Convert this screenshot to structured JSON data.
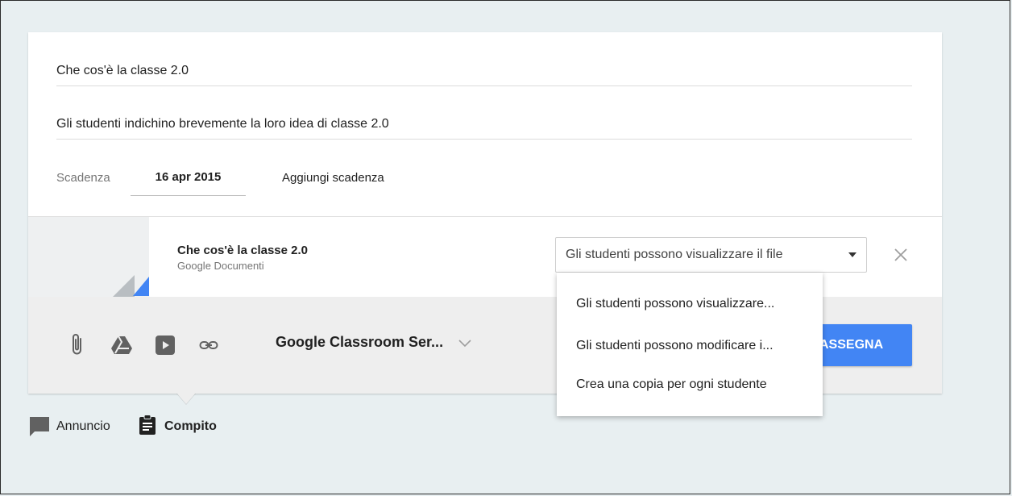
{
  "assignment": {
    "title": "Che cos'è la classe 2.0",
    "description": "Gli studenti indichino brevemente la loro idea di classe 2.0",
    "due_label": "Scadenza",
    "due_date": "16 apr 2015",
    "add_due": "Aggiungi scadenza"
  },
  "attachment": {
    "title": "Che cos'è la classe 2.0",
    "subtitle": "Google Documenti",
    "permission_selected": "Gli studenti possono visualizzare il file"
  },
  "permission_menu": [
    "Gli studenti possono visualizzare...",
    "Gli studenti possono modificare i...",
    "Crea una copia per ogni studente"
  ],
  "toolbar": {
    "icons": [
      "paperclip-icon",
      "google-drive-icon",
      "youtube-icon",
      "link-icon"
    ],
    "class_name": "Google Classroom Ser...",
    "assign_label": "ASSEGNA"
  },
  "post_types": {
    "announcement": "Annuncio",
    "assignment": "Compito"
  },
  "colors": {
    "accent": "#4285f4",
    "background": "#e8eff1",
    "toolbar": "#eeeeee"
  }
}
